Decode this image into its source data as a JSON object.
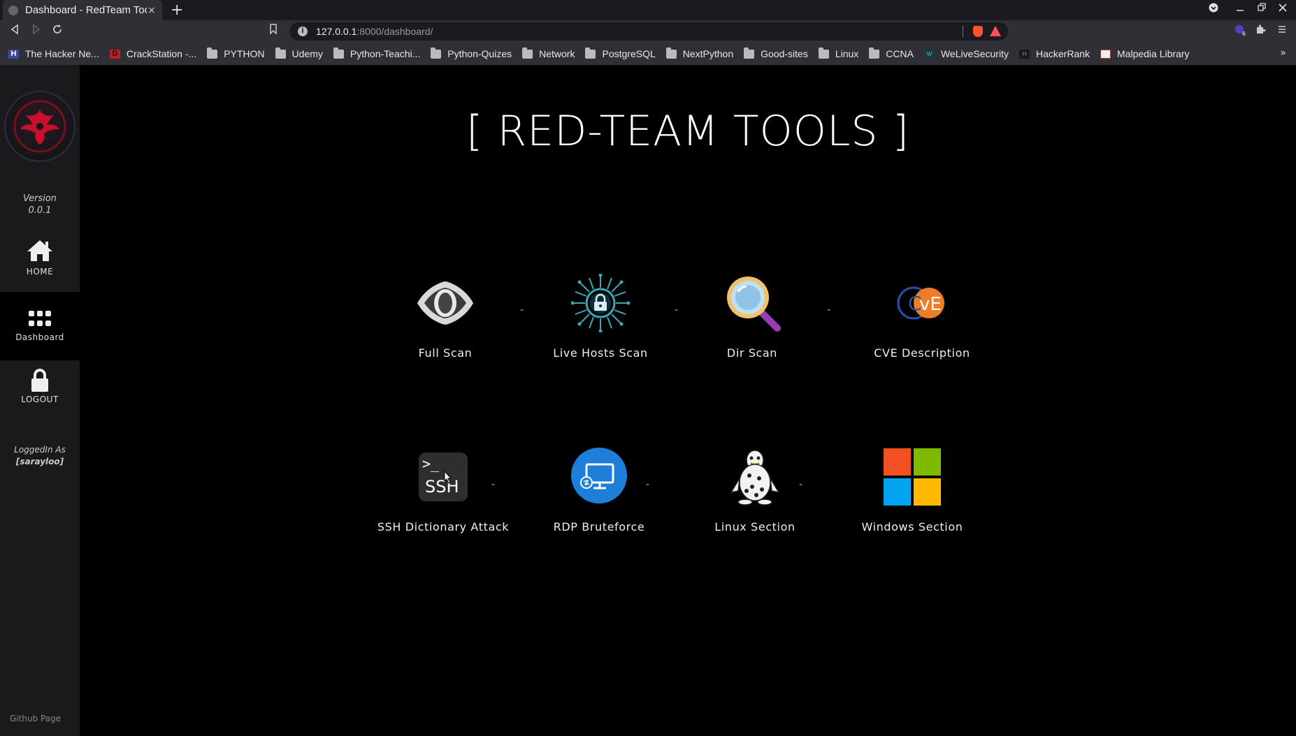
{
  "browser": {
    "tab_title": "Dashboard - RedTeam Too",
    "tab_close": "×",
    "new_tab": "+",
    "url_host": "127.0.0.1",
    "url_path": ":8000/dashboard/",
    "bookmarks": [
      {
        "label": "The Hacker Ne...",
        "icon": "hn"
      },
      {
        "label": "CrackStation -...",
        "icon": "cs"
      },
      {
        "label": "PYTHON",
        "icon": "folder"
      },
      {
        "label": "Udemy",
        "icon": "folder"
      },
      {
        "label": "Python-Teachi...",
        "icon": "folder"
      },
      {
        "label": "Python-Quizes",
        "icon": "folder"
      },
      {
        "label": "Network",
        "icon": "folder"
      },
      {
        "label": "PostgreSQL",
        "icon": "folder"
      },
      {
        "label": "NextPython",
        "icon": "folder"
      },
      {
        "label": "Good-sites",
        "icon": "folder"
      },
      {
        "label": "Linux",
        "icon": "folder"
      },
      {
        "label": "CCNA",
        "icon": "folder"
      },
      {
        "label": "WeLiveSecurity",
        "icon": "wls"
      },
      {
        "label": "HackerRank",
        "icon": "hr"
      },
      {
        "label": "Malpedia Library",
        "icon": "mp"
      }
    ],
    "more": "»"
  },
  "sidebar": {
    "version_label": "Version",
    "version_value": "0.0.1",
    "home": "HOME",
    "dashboard": "Dashboard",
    "logout": "LOGOUT",
    "logged_label": "LoggedIn As",
    "username": "[sarayloo]",
    "github": "Github Page"
  },
  "main": {
    "title": "[ RED-TEAM TOOLS ]",
    "separator": "-",
    "tools_row1": [
      "Full Scan",
      "Live Hosts Scan",
      "Dir Scan",
      "CVE Description"
    ],
    "tools_row2": [
      "SSH Dictionary Attack",
      "RDP Bruteforce",
      "Linux Section",
      "Windows Section"
    ],
    "ssh_icon_prompt": ">_",
    "ssh_icon_text": "SSH",
    "cve_icon_c": "C",
    "cve_icon_ve": "vE"
  },
  "colors": {
    "accent_red": "#c8102e",
    "win_red": "#f25022",
    "win_green": "#7fba00",
    "win_blue": "#00a4ef",
    "win_yellow": "#ffb900",
    "rdp_blue": "#1e7fd8",
    "cve_orange": "#f07c25"
  }
}
